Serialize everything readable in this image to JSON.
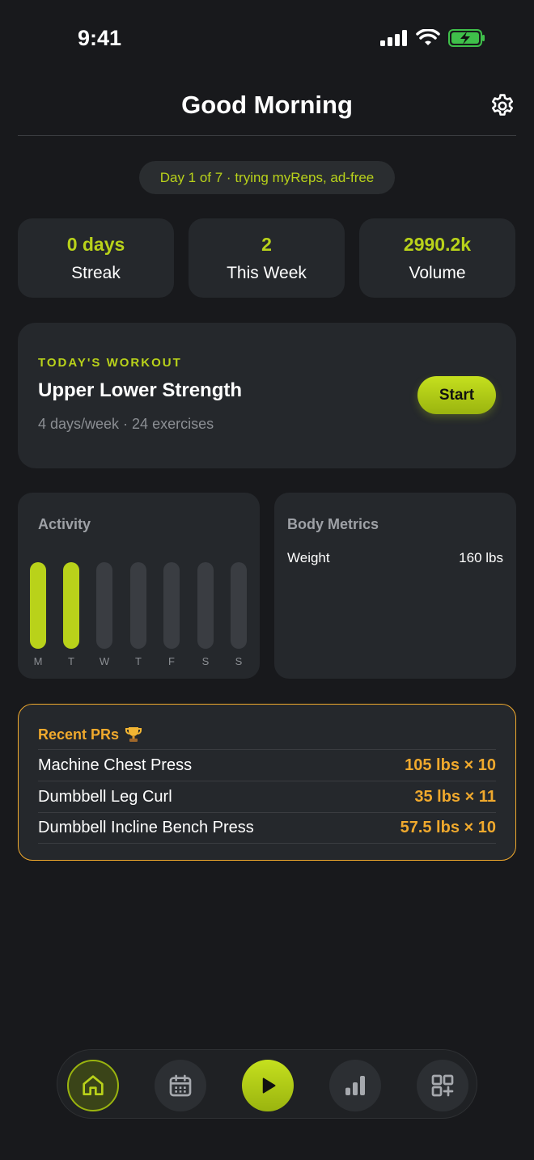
{
  "status": {
    "time": "9:41"
  },
  "header": {
    "title": "Good Morning"
  },
  "trial": {
    "text": "Day 1 of 7 · trying myReps, ad-free"
  },
  "stats": [
    {
      "value": "0 days",
      "label": "Streak"
    },
    {
      "value": "2",
      "label": "This Week"
    },
    {
      "value": "2990.2k",
      "label": "Volume"
    }
  ],
  "workout": {
    "eyebrow": "TODAY'S WORKOUT",
    "title": "Upper Lower Strength",
    "subtitle": "4 days/week · 24 exercises",
    "start_label": "Start"
  },
  "activity": {
    "title": "Activity",
    "days": [
      "M",
      "T",
      "W",
      "T",
      "F",
      "S",
      "S"
    ],
    "active": [
      true,
      true,
      false,
      false,
      false,
      false,
      false
    ]
  },
  "metrics": {
    "title": "Body Metrics",
    "rows": [
      {
        "label": "Weight",
        "value": "160 lbs"
      }
    ]
  },
  "prs": {
    "title": "Recent PRs",
    "icon": "trophy-icon",
    "rows": [
      {
        "name": "Machine Chest Press",
        "value": "105 lbs × 10"
      },
      {
        "name": "Dumbbell Leg Curl",
        "value": "35 lbs × 11"
      },
      {
        "name": "Dumbbell Incline Bench Press",
        "value": "57.5 lbs × 10"
      }
    ]
  },
  "tabs": [
    {
      "name": "home",
      "icon": "home-icon"
    },
    {
      "name": "calendar",
      "icon": "calendar-icon"
    },
    {
      "name": "play",
      "icon": "play-icon"
    },
    {
      "name": "stats",
      "icon": "bar-chart-icon"
    },
    {
      "name": "more",
      "icon": "grid-plus-icon"
    }
  ],
  "colors": {
    "accent": "#b9d21a",
    "pr": "#f0a92d",
    "background": "#18191c",
    "card": "#25282c"
  }
}
